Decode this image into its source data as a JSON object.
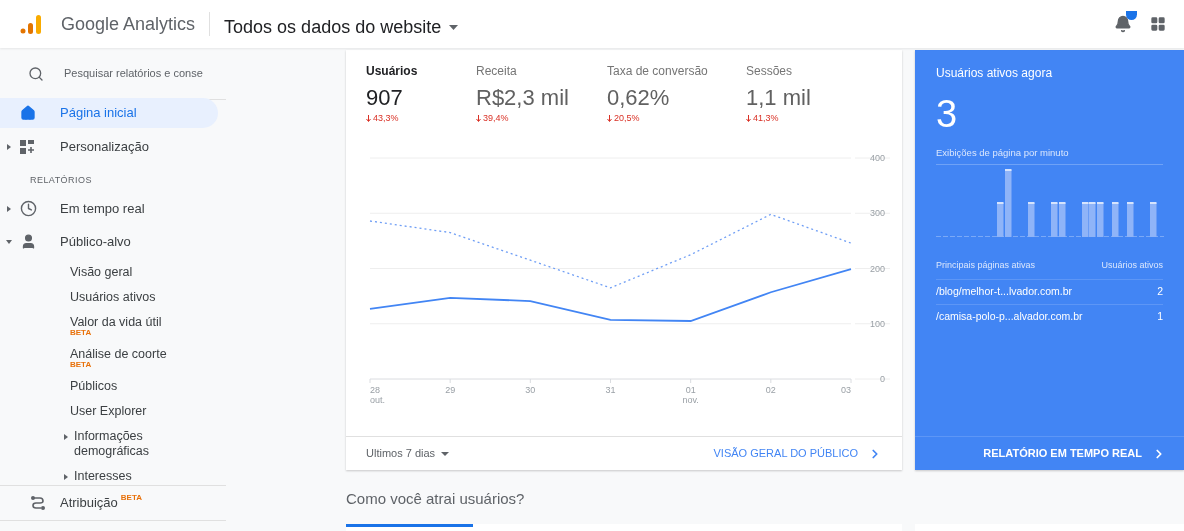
{
  "header": {
    "product": "Google Analytics",
    "property": "Todos os dados do website",
    "notification_badge": true
  },
  "sidebar": {
    "search": {
      "placeholder": "Pesquisar relatórios e conse"
    },
    "items": [
      {
        "label": "Página inicial",
        "selected": true
      },
      {
        "label": "Personalização",
        "selected": false,
        "expanded": false
      }
    ],
    "section_title": "RELATÓRIOS",
    "reports": [
      {
        "label": "Em tempo real",
        "selected": false,
        "expanded": false
      },
      {
        "label": "Público-alvo",
        "selected": false,
        "expanded": true,
        "children": [
          {
            "label": "Visão geral",
            "selected": false
          },
          {
            "label": "Usuários ativos",
            "selected": false
          },
          {
            "label": "Valor da vida útil",
            "badge": "BETA",
            "selected": false
          },
          {
            "label": "Análise de coorte",
            "badge": "BETA",
            "selected": false
          },
          {
            "label": "Públicos",
            "selected": false
          },
          {
            "label": "User Explorer",
            "selected": false
          },
          {
            "label": "Informações demográficas",
            "selected": false,
            "expanded": false
          },
          {
            "label": "Interesses",
            "selected": false,
            "expanded": false
          }
        ]
      }
    ],
    "bottom_item": {
      "label": "Atribuição",
      "badge": "BETA"
    }
  },
  "overview": {
    "metrics": [
      {
        "label": "Usuários",
        "value": "907",
        "change": "43,3%",
        "selected": true
      },
      {
        "label": "Receita",
        "value": "R$2,3 mil",
        "change": "39,4%",
        "selected": false
      },
      {
        "label": "Taxa de conversão",
        "value": "0,62%",
        "change": "20,5%",
        "selected": false
      },
      {
        "label": "Sessões",
        "value": "1,1 mil",
        "change": "41,3%",
        "selected": false
      }
    ],
    "chart_data": {
      "type": "line",
      "categories": [
        "28 out.",
        "29",
        "30",
        "31",
        "01 nov.",
        "02",
        "03"
      ],
      "ylim": [
        0,
        400
      ],
      "grid": true,
      "yticks": [
        0,
        100,
        200,
        300,
        400
      ],
      "series": [
        {
          "color": "#4285f4",
          "line_style": "solid",
          "values": [
            127,
            147,
            141,
            107,
            105,
            157,
            199
          ]
        },
        {
          "color": "#6f9ef5",
          "line_style": "dotted",
          "values": [
            286,
            265,
            215,
            165,
            225,
            298,
            246
          ]
        }
      ]
    },
    "date_range": "Ultimos 7 dias",
    "link": "VISÃO GERAL DO PÚBLICO"
  },
  "section_heading": "Como você atrai usuários?",
  "realtime": {
    "title": "Usuários ativos agora",
    "count": "3",
    "subtitle": "Exibições de página por minuto",
    "table": {
      "columns": [
        "Principais páginas ativas",
        "Usuários ativos"
      ],
      "rows": [
        [
          "/blog/melhor-t...lvador.com.br",
          "2"
        ],
        [
          "/camisa-polo-p...alvador.com.br",
          "1"
        ]
      ]
    },
    "link": "RELATÓRIO EM TEMPO REAL"
  }
}
